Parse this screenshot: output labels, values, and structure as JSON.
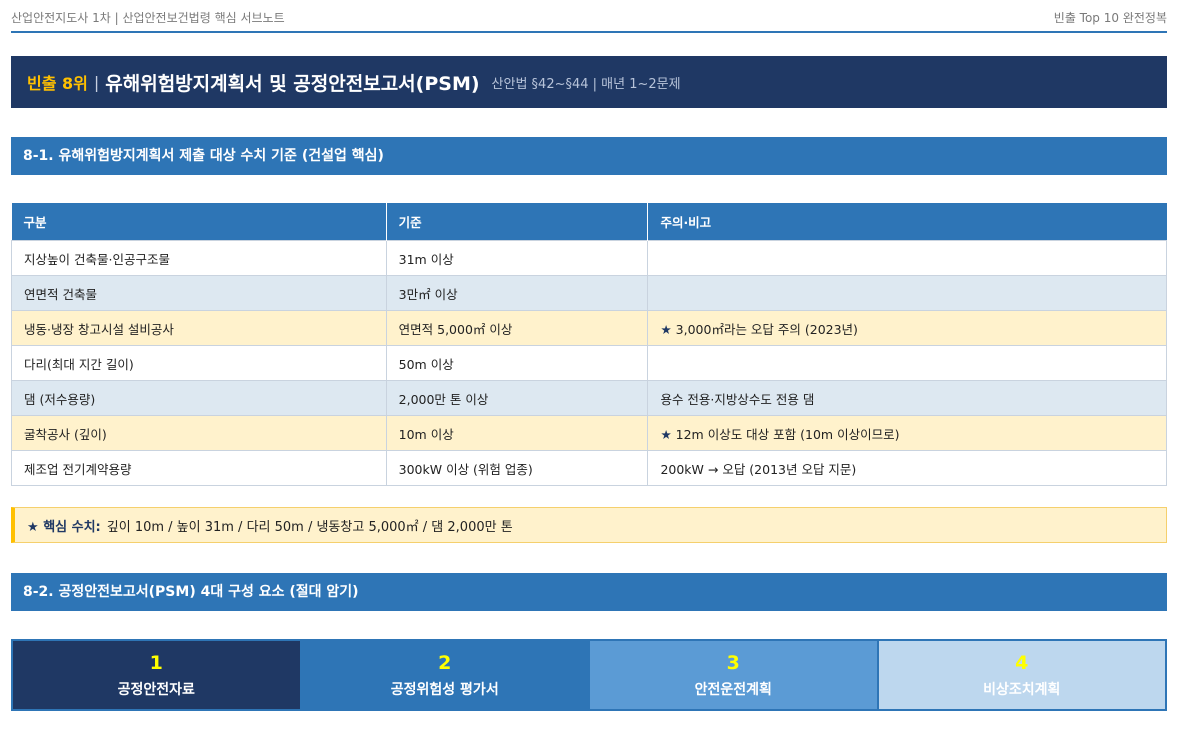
{
  "header": {
    "left": "산업안전지도사 1차 | 산업안전보건법령 핵심 서브노트",
    "right": "빈출 Top 10 완전정복"
  },
  "banner": {
    "rank": "빈출 8위",
    "separator": "|",
    "title": "유해위험방지계획서 및 공정안전보고서(PSM)",
    "subtitle": "산안법 §42~§44 | 매년 1~2문제"
  },
  "section1": {
    "title": "8-1. 유해위험방지계획서 제출 대상 수치 기준 (건설업 핵심)",
    "columns": [
      "구분",
      "기준",
      "주의·비고"
    ],
    "rows": [
      {
        "category": "지상높이 건축물·인공구조물",
        "criteria": "31m 이상",
        "note": "",
        "star": false
      },
      {
        "category": "연면적 건축물",
        "criteria": "3만㎡ 이상",
        "note": "",
        "star": false
      },
      {
        "category": "냉동·냉장 창고시설 설비공사",
        "criteria": "연면적 5,000㎡ 이상",
        "note": "3,000㎡라는 오답 주의 (2023년)",
        "star": true
      },
      {
        "category": "다리(최대 지간 길이)",
        "criteria": "50m 이상",
        "note": "",
        "star": false
      },
      {
        "category": "댐 (저수용량)",
        "criteria": "2,000만 톤 이상",
        "note": "용수 전용·지방상수도 전용 댐",
        "star": false
      },
      {
        "category": "굴착공사 (깊이)",
        "criteria": "10m 이상",
        "note": "12m 이상도 대상 포함 (10m 이상이므로)",
        "star": true
      },
      {
        "category": "제조업 전기계약용량",
        "criteria": "300kW 이상 (위험 업종)",
        "note": "200kW → 오답 (2013년 오답 지문)",
        "star": false
      }
    ],
    "row_styles": [
      "white",
      "blue",
      "yellow",
      "white",
      "blue",
      "yellow",
      "white"
    ],
    "star_glyph": "★"
  },
  "callout": {
    "star": "★",
    "lead": "핵심 수치:",
    "text": "깊이 10m / 높이 31m / 다리 50m / 냉동창고 5,000㎡ / 댐 2,000만 톤"
  },
  "section2": {
    "title": "8-2. 공정안전보고서(PSM) 4대 구성 요소 (절대 암기)",
    "items": [
      {
        "num": "1",
        "label": "공정안전자료",
        "bg": "#1f3864"
      },
      {
        "num": "2",
        "label": "공정위험성 평가서",
        "bg": "#2e75b6"
      },
      {
        "num": "3",
        "label": "안전운전계획",
        "bg": "#5b9bd5"
      },
      {
        "num": "4",
        "label": "비상조치계획",
        "bg": "#bdd7ee"
      }
    ]
  },
  "colors": {
    "navy": "#1f3864",
    "blue": "#2e75b6",
    "accent_yellow": "#ffc000",
    "highlight_row": "#fff2cc",
    "alt_row": "#dde8f1"
  }
}
